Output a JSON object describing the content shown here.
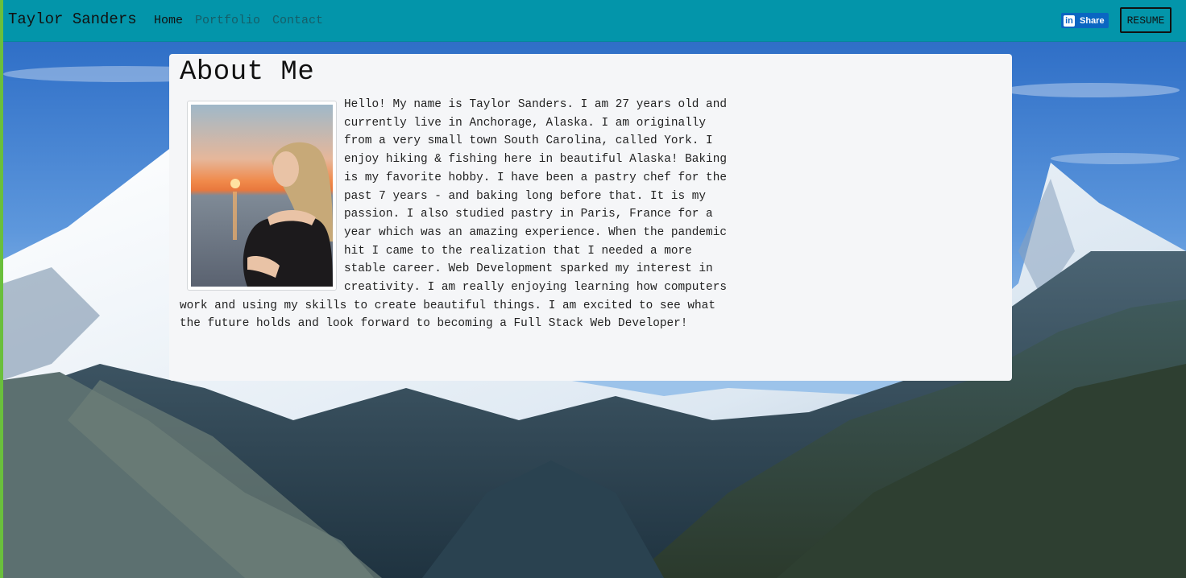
{
  "navbar": {
    "brand": "Taylor Sanders",
    "links": [
      {
        "label": "Home",
        "active": true
      },
      {
        "label": "Portfolio",
        "active": false
      },
      {
        "label": "Contact",
        "active": false
      }
    ],
    "share_label": "Share",
    "share_icon": "linkedin-icon",
    "resume_label": "RESUME",
    "background_color": "#0395aa"
  },
  "about": {
    "title": "About Me",
    "body": "Hello! My name is Taylor Sanders. I am 27 years old and currently live in Anchorage, Alaska. I am originally from a very small town South Carolina, called York. I enjoy hiking & fishing here in beautiful Alaska! Baking is my favorite hobby. I have been a pastry chef for the past 7 years - and baking long before that. It is my passion. I also studied pastry in Paris, France for a year which was an amazing experience. When the pandemic hit I came to the realization that I needed a more stable career. Web Development sparked my interest in creativity. I am really enjoying learning how computers work and using my skills to create beautiful things. I am excited to see what the future holds and look forward to becoming a Full Stack Web Developer!"
  },
  "colors": {
    "card_background": "#f5f6f8",
    "linkedin_blue": "#0a66c2"
  }
}
